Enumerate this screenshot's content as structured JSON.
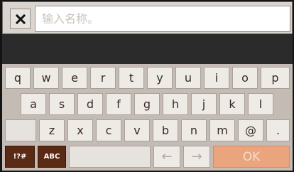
{
  "input": {
    "value": "",
    "placeholder": "输入名称。"
  },
  "keyboard": {
    "row1": [
      "q",
      "w",
      "e",
      "r",
      "t",
      "y",
      "u",
      "i",
      "o",
      "p"
    ],
    "row2": [
      "a",
      "s",
      "d",
      "f",
      "g",
      "h",
      "j",
      "k",
      "l"
    ],
    "row3": [
      "z",
      "x",
      "c",
      "v",
      "b",
      "n",
      "m",
      "@",
      "."
    ],
    "symbols_label": "!?#",
    "abc_label": "ABC",
    "left_arrow": "←",
    "right_arrow": "→",
    "ok_label": "OK"
  },
  "icons": {
    "close": "close-icon"
  },
  "colors": {
    "topbar_bg": "#d9d4ce",
    "keyboard_bg": "#c3bbb4",
    "key_bg": "#eeebe7",
    "key_text": "#3a2a20",
    "mode_key_bg": "#5a2a14",
    "ok_bg": "#eaa57e",
    "ok_text": "#f6dccb",
    "dark_strip": "#2b2b2b"
  }
}
